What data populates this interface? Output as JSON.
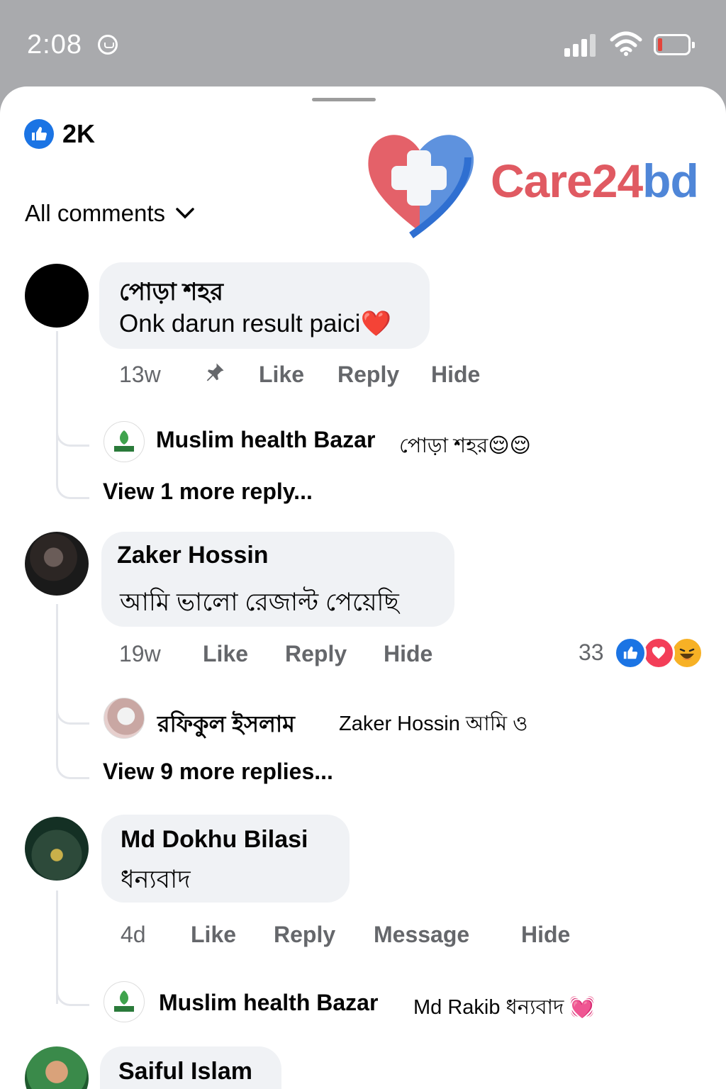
{
  "status_bar": {
    "time": "2:08",
    "icons": [
      "do-not-disturb-icon",
      "signal-icon",
      "wifi-icon",
      "battery-low-icon"
    ]
  },
  "reactions_summary": {
    "count": "2K",
    "icon": "like-icon"
  },
  "filter": {
    "label": "All comments",
    "icon": "chevron-down-icon"
  },
  "watermark": {
    "part1": "Care24",
    "part2": "bd",
    "colors": [
      "#e05a62",
      "#4f86d8"
    ]
  },
  "comments": [
    {
      "author": "পোড়া শহর",
      "text": "Onk darun result paici",
      "emoji": "❤️",
      "time": "13w",
      "pinned": true,
      "actions": [
        "Like",
        "Reply",
        "Hide"
      ],
      "reply": {
        "author": "Muslim health Bazar",
        "text": "পোড়া শহর",
        "emoji": "😌😌"
      },
      "view_more": "View 1 more reply..."
    },
    {
      "author": "Zaker Hossin",
      "text": "আমি ভালো রেজাল্ট পেয়েছি",
      "time": "19w",
      "actions": [
        "Like",
        "Reply",
        "Hide"
      ],
      "reaction_count": "33",
      "reactions": [
        "like-icon",
        "love-icon",
        "haha-icon"
      ],
      "reply": {
        "author": "রফিকুল ইসলাম",
        "text": "Zaker Hossin আমি ও"
      },
      "view_more": "View 9 more replies..."
    },
    {
      "author": "Md Dokhu Bilasi",
      "text": "ধন্যবাদ",
      "time": "4d",
      "actions": [
        "Like",
        "Reply",
        "Message",
        "Hide"
      ],
      "reply": {
        "author": "Muslim health Bazar",
        "text": "Md Rakib ধন্যবাদ",
        "emoji": "💓"
      }
    },
    {
      "author": "Saiful Islam"
    }
  ],
  "colors": {
    "accent": "#1b74e4",
    "bubble": "#f0f2f5",
    "meta": "#65676b",
    "love": "#f33e58",
    "haha": "#f7b125"
  }
}
